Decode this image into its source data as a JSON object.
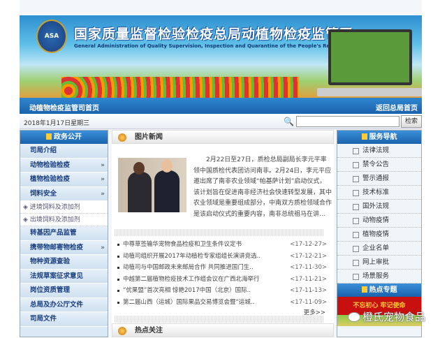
{
  "header": {
    "title": "国家质量监督检验检疫总局动植物检疫监管司",
    "subtitle": "General Administration of Quality Supervision, Inspection and Quarantine of the People's Republic of China",
    "emblem_text": "ASA"
  },
  "nav": {
    "home": "动植物检疫监管司首页",
    "back": "返回总局首页"
  },
  "datebar": {
    "date": "2018年1月17日星期三",
    "search_placeholder": "",
    "search_button": "检索"
  },
  "left": {
    "title": "政务公开",
    "items": [
      {
        "label": "司局介绍"
      },
      {
        "label": "动物检验检疫",
        "chev": "»"
      },
      {
        "label": "植物检验检疫",
        "chev": "»"
      },
      {
        "label": "饲料安全",
        "chev": "»"
      }
    ],
    "subitems": [
      "进境饲料及添加剂",
      "出境饲料及添加剂"
    ],
    "items2": [
      {
        "label": "转基因产品监管"
      },
      {
        "label": "携带物邮寄物检疫",
        "chev": "»"
      },
      {
        "label": "物种资源查验"
      },
      {
        "label": "法规草案征求意见"
      },
      {
        "label": "岗位资质管理"
      },
      {
        "label": "总局及办公厅文件"
      },
      {
        "label": "司局文件"
      }
    ]
  },
  "main": {
    "section_title": "图片新闻",
    "feature": "2月22日至27日，质检总局副局长李元平率领中国质检代表团访问南非。2月24日，李元平应邀出席了南非农业领域“帕基萨计划”启动仪式，该计划旨在促进南非经济社会快速转型发展，其中农业领域是重要组成部分，中南双方质检领域合作是该启动仪式的重要内容，南非总统祖马在讲...",
    "news": [
      {
        "title": "中尊草签输华宠物食品检疫和卫生条件议定书",
        "date": "<17-12-27>"
      },
      {
        "title": "动植司组织开展2017年动植检专家组组长演讲竞选..",
        "date": "<17-12-21>"
      },
      {
        "title": "动植司与中国邮政未来邮局合作 共同推进国门生..",
        "date": "<17-11-30>"
      },
      {
        "title": "中越第二届植物检疫技术工作组会议在广西北海举行",
        "date": "<17-11-21>"
      },
      {
        "title": "“优果盟”首次亮相 惊艳2017中国（北京）国际..",
        "date": "<17-11-13>"
      },
      {
        "title": "第二届山西（运城）国际果品交易博览会暨“运城..",
        "date": "<17-11-09>"
      }
    ],
    "more": "更多>>",
    "hot_title": "热点关注"
  },
  "right": {
    "title": "服务导航",
    "items": [
      "法律法规",
      "禁令公告",
      "警示通报",
      "技术标准",
      "国外法规",
      "动物疫情",
      "植物疫情",
      "企业名单",
      "网上审批",
      "场景服务"
    ],
    "hot_title": "热点专题",
    "promo": "不忘初心 牢记使命"
  },
  "watermark": "橙氏宠物食品"
}
